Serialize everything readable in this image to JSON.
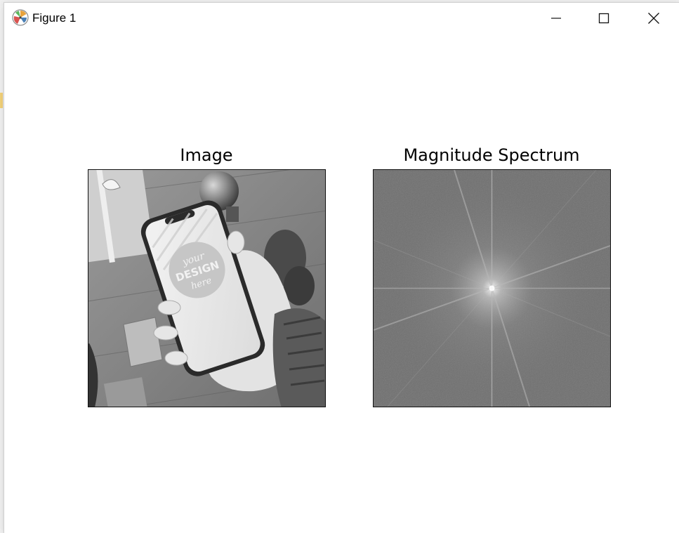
{
  "window": {
    "title": "Figure 1",
    "icon": "matplotlib-icon",
    "controls": {
      "minimize_icon": "minimize-icon",
      "maximize_icon": "maximize-icon",
      "close_icon": "close-icon"
    }
  },
  "figure": {
    "subplots": [
      {
        "title": "Image",
        "content": "grayscale-photo"
      },
      {
        "title": "Magnitude Spectrum",
        "content": "fft-magnitude-spectrum"
      }
    ]
  },
  "colors": {
    "spectrum_bg": "#6f6f6f",
    "frame": "#111111",
    "title_text": "#000000"
  }
}
